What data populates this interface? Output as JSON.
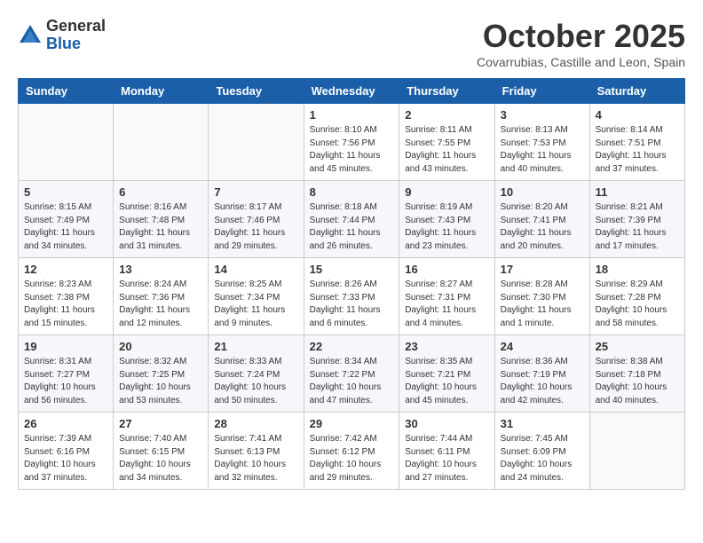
{
  "logo": {
    "general": "General",
    "blue": "Blue"
  },
  "header": {
    "month": "October 2025",
    "location": "Covarrubias, Castille and Leon, Spain"
  },
  "days_of_week": [
    "Sunday",
    "Monday",
    "Tuesday",
    "Wednesday",
    "Thursday",
    "Friday",
    "Saturday"
  ],
  "weeks": [
    [
      {
        "day": "",
        "info": ""
      },
      {
        "day": "",
        "info": ""
      },
      {
        "day": "",
        "info": ""
      },
      {
        "day": "1",
        "info": "Sunrise: 8:10 AM\nSunset: 7:56 PM\nDaylight: 11 hours\nand 45 minutes."
      },
      {
        "day": "2",
        "info": "Sunrise: 8:11 AM\nSunset: 7:55 PM\nDaylight: 11 hours\nand 43 minutes."
      },
      {
        "day": "3",
        "info": "Sunrise: 8:13 AM\nSunset: 7:53 PM\nDaylight: 11 hours\nand 40 minutes."
      },
      {
        "day": "4",
        "info": "Sunrise: 8:14 AM\nSunset: 7:51 PM\nDaylight: 11 hours\nand 37 minutes."
      }
    ],
    [
      {
        "day": "5",
        "info": "Sunrise: 8:15 AM\nSunset: 7:49 PM\nDaylight: 11 hours\nand 34 minutes."
      },
      {
        "day": "6",
        "info": "Sunrise: 8:16 AM\nSunset: 7:48 PM\nDaylight: 11 hours\nand 31 minutes."
      },
      {
        "day": "7",
        "info": "Sunrise: 8:17 AM\nSunset: 7:46 PM\nDaylight: 11 hours\nand 29 minutes."
      },
      {
        "day": "8",
        "info": "Sunrise: 8:18 AM\nSunset: 7:44 PM\nDaylight: 11 hours\nand 26 minutes."
      },
      {
        "day": "9",
        "info": "Sunrise: 8:19 AM\nSunset: 7:43 PM\nDaylight: 11 hours\nand 23 minutes."
      },
      {
        "day": "10",
        "info": "Sunrise: 8:20 AM\nSunset: 7:41 PM\nDaylight: 11 hours\nand 20 minutes."
      },
      {
        "day": "11",
        "info": "Sunrise: 8:21 AM\nSunset: 7:39 PM\nDaylight: 11 hours\nand 17 minutes."
      }
    ],
    [
      {
        "day": "12",
        "info": "Sunrise: 8:23 AM\nSunset: 7:38 PM\nDaylight: 11 hours\nand 15 minutes."
      },
      {
        "day": "13",
        "info": "Sunrise: 8:24 AM\nSunset: 7:36 PM\nDaylight: 11 hours\nand 12 minutes."
      },
      {
        "day": "14",
        "info": "Sunrise: 8:25 AM\nSunset: 7:34 PM\nDaylight: 11 hours\nand 9 minutes."
      },
      {
        "day": "15",
        "info": "Sunrise: 8:26 AM\nSunset: 7:33 PM\nDaylight: 11 hours\nand 6 minutes."
      },
      {
        "day": "16",
        "info": "Sunrise: 8:27 AM\nSunset: 7:31 PM\nDaylight: 11 hours\nand 4 minutes."
      },
      {
        "day": "17",
        "info": "Sunrise: 8:28 AM\nSunset: 7:30 PM\nDaylight: 11 hours\nand 1 minute."
      },
      {
        "day": "18",
        "info": "Sunrise: 8:29 AM\nSunset: 7:28 PM\nDaylight: 10 hours\nand 58 minutes."
      }
    ],
    [
      {
        "day": "19",
        "info": "Sunrise: 8:31 AM\nSunset: 7:27 PM\nDaylight: 10 hours\nand 56 minutes."
      },
      {
        "day": "20",
        "info": "Sunrise: 8:32 AM\nSunset: 7:25 PM\nDaylight: 10 hours\nand 53 minutes."
      },
      {
        "day": "21",
        "info": "Sunrise: 8:33 AM\nSunset: 7:24 PM\nDaylight: 10 hours\nand 50 minutes."
      },
      {
        "day": "22",
        "info": "Sunrise: 8:34 AM\nSunset: 7:22 PM\nDaylight: 10 hours\nand 47 minutes."
      },
      {
        "day": "23",
        "info": "Sunrise: 8:35 AM\nSunset: 7:21 PM\nDaylight: 10 hours\nand 45 minutes."
      },
      {
        "day": "24",
        "info": "Sunrise: 8:36 AM\nSunset: 7:19 PM\nDaylight: 10 hours\nand 42 minutes."
      },
      {
        "day": "25",
        "info": "Sunrise: 8:38 AM\nSunset: 7:18 PM\nDaylight: 10 hours\nand 40 minutes."
      }
    ],
    [
      {
        "day": "26",
        "info": "Sunrise: 7:39 AM\nSunset: 6:16 PM\nDaylight: 10 hours\nand 37 minutes."
      },
      {
        "day": "27",
        "info": "Sunrise: 7:40 AM\nSunset: 6:15 PM\nDaylight: 10 hours\nand 34 minutes."
      },
      {
        "day": "28",
        "info": "Sunrise: 7:41 AM\nSunset: 6:13 PM\nDaylight: 10 hours\nand 32 minutes."
      },
      {
        "day": "29",
        "info": "Sunrise: 7:42 AM\nSunset: 6:12 PM\nDaylight: 10 hours\nand 29 minutes."
      },
      {
        "day": "30",
        "info": "Sunrise: 7:44 AM\nSunset: 6:11 PM\nDaylight: 10 hours\nand 27 minutes."
      },
      {
        "day": "31",
        "info": "Sunrise: 7:45 AM\nSunset: 6:09 PM\nDaylight: 10 hours\nand 24 minutes."
      },
      {
        "day": "",
        "info": ""
      }
    ]
  ]
}
